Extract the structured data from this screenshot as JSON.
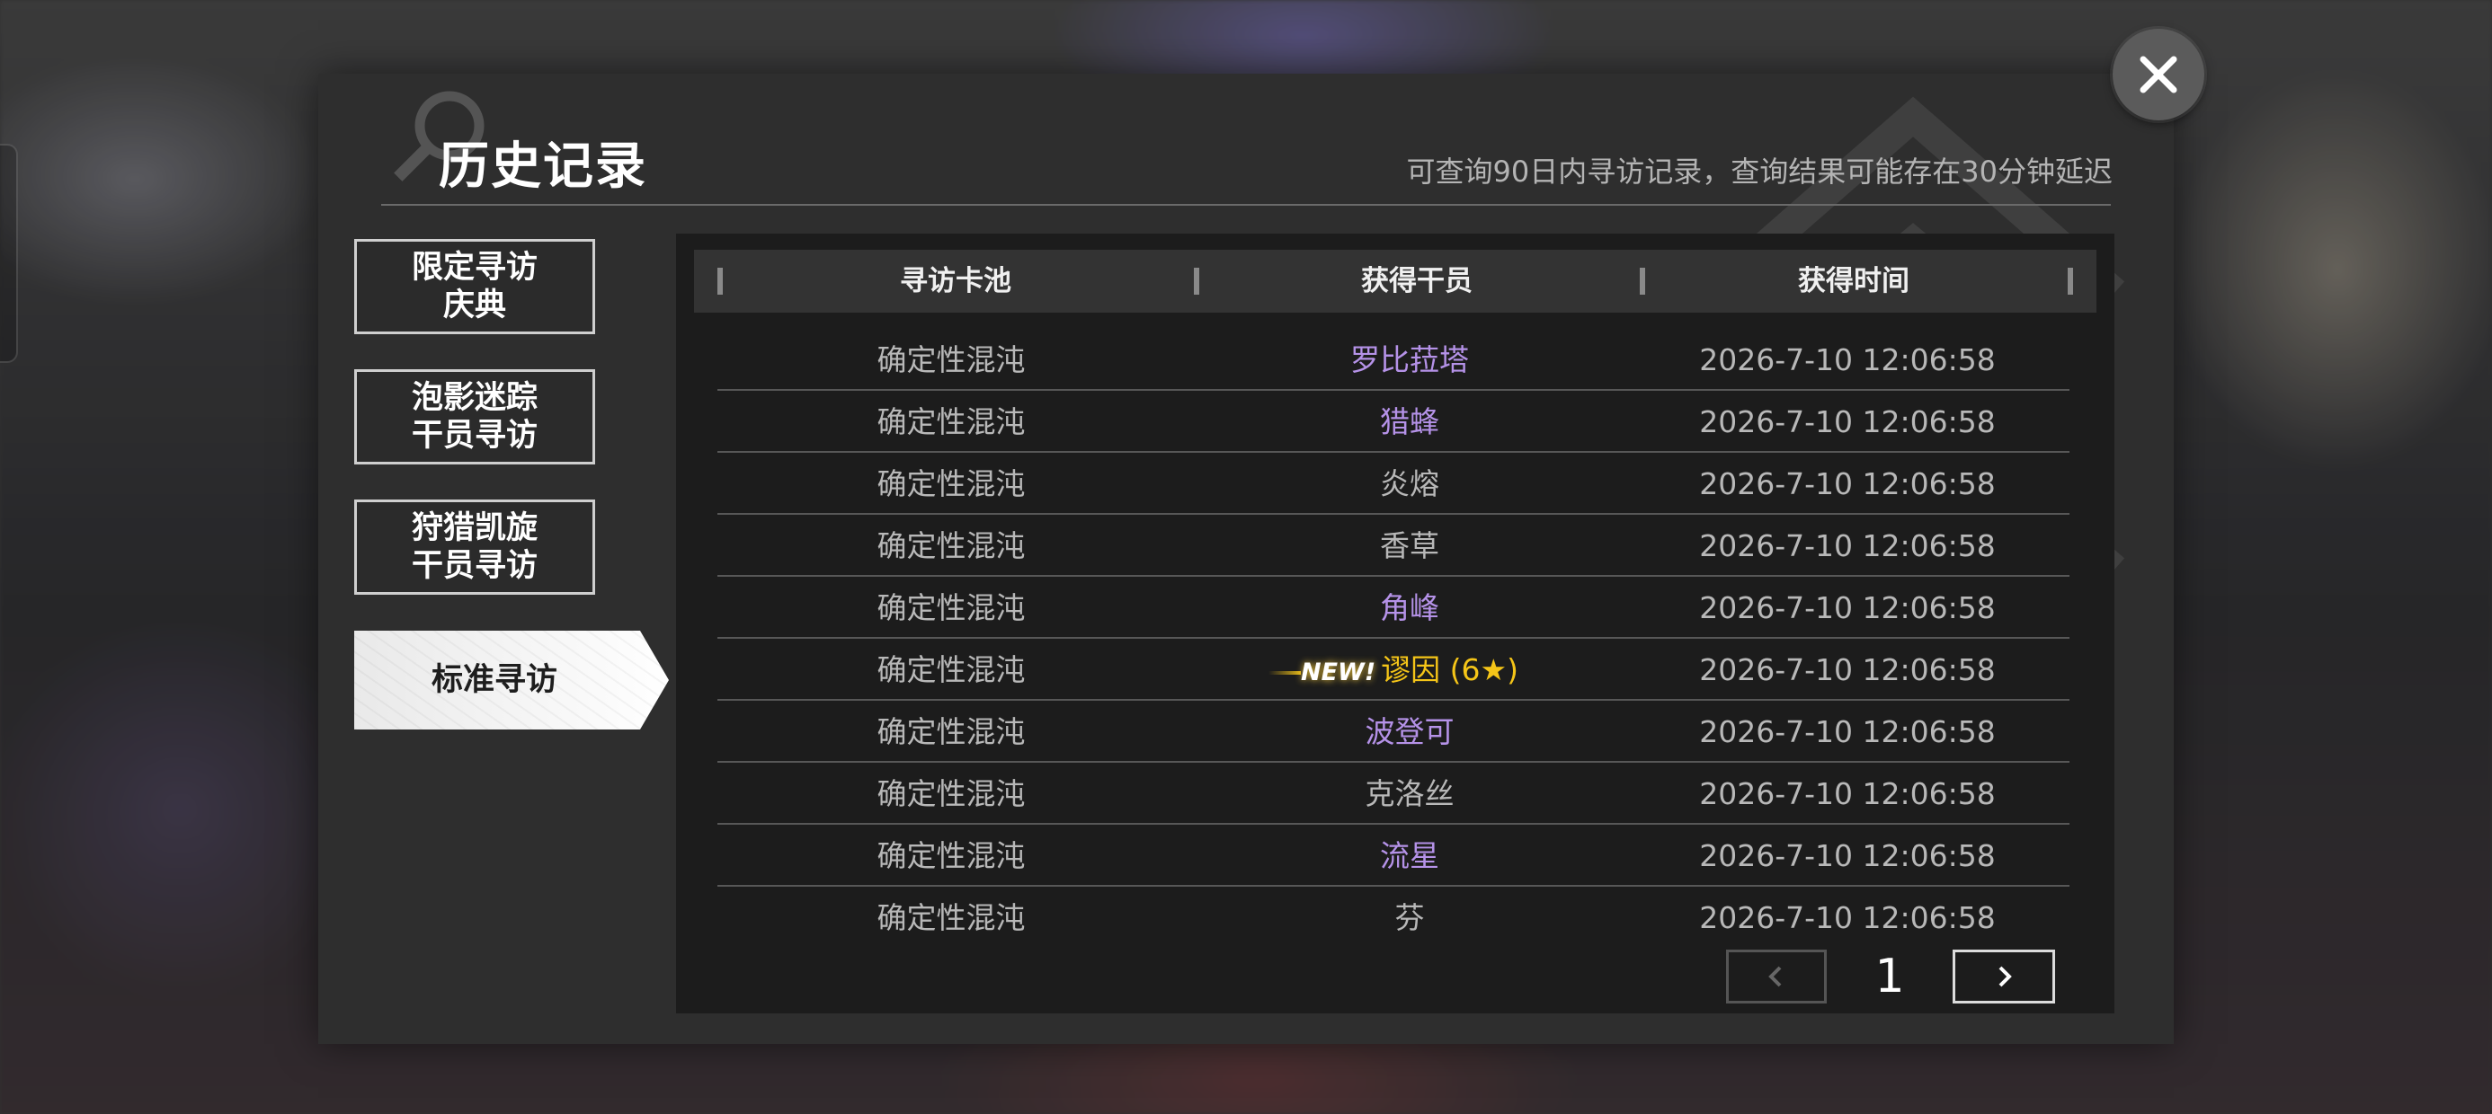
{
  "title": "历史记录",
  "subtitle": "可查询90日内寻访记录，查询结果可能存在30分钟延迟",
  "tabs": [
    {
      "line1": "限定寻访",
      "line2": "庆典"
    },
    {
      "line1": "泡影迷踪",
      "line2": "干员寻访"
    },
    {
      "line1": "狩猎凯旋",
      "line2": "干员寻访"
    },
    {
      "line1": "标准寻访",
      "line2": ""
    }
  ],
  "active_tab": 3,
  "table": {
    "headers": [
      "寻访卡池",
      "获得干员",
      "获得时间"
    ],
    "rows": [
      {
        "pool": "确定性混沌",
        "operator": "罗比菈塔",
        "time": "2026-7-10 12:06:58",
        "rarity_color": "#b592e8"
      },
      {
        "pool": "确定性混沌",
        "operator": "猎蜂",
        "time": "2026-7-10 12:06:58",
        "rarity_color": "#b592e8"
      },
      {
        "pool": "确定性混沌",
        "operator": "炎熔",
        "time": "2026-7-10 12:06:58",
        "rarity_color": "#b8b8b8"
      },
      {
        "pool": "确定性混沌",
        "operator": "香草",
        "time": "2026-7-10 12:06:58",
        "rarity_color": "#b8b8b8"
      },
      {
        "pool": "确定性混沌",
        "operator": "角峰",
        "time": "2026-7-10 12:06:58",
        "rarity_color": "#b592e8"
      },
      {
        "pool": "确定性混沌",
        "operator": "谬因 (6★)",
        "time": "2026-7-10 12:06:58",
        "rarity_color": "#f5c518",
        "badge": "NEW!"
      },
      {
        "pool": "确定性混沌",
        "operator": "波登可",
        "time": "2026-7-10 12:06:58",
        "rarity_color": "#b592e8"
      },
      {
        "pool": "确定性混沌",
        "operator": "克洛丝",
        "time": "2026-7-10 12:06:58",
        "rarity_color": "#b8b8b8"
      },
      {
        "pool": "确定性混沌",
        "operator": "流星",
        "time": "2026-7-10 12:06:58",
        "rarity_color": "#b592e8"
      },
      {
        "pool": "确定性混沌",
        "operator": "芬",
        "time": "2026-7-10 12:06:58",
        "rarity_color": "#b8b8b8"
      }
    ]
  },
  "pager": {
    "current_page": "1"
  },
  "icons": {
    "close": "close-icon",
    "prev": "chevron-left-icon",
    "next": "chevron-right-icon",
    "search_deco": "search-icon"
  },
  "colors": {
    "six_star": "#f5c518",
    "five_star": "#b592e8",
    "normal": "#b8b8b8",
    "panel_bg": "#2e2e2e",
    "table_bg": "#1c1c1c"
  }
}
